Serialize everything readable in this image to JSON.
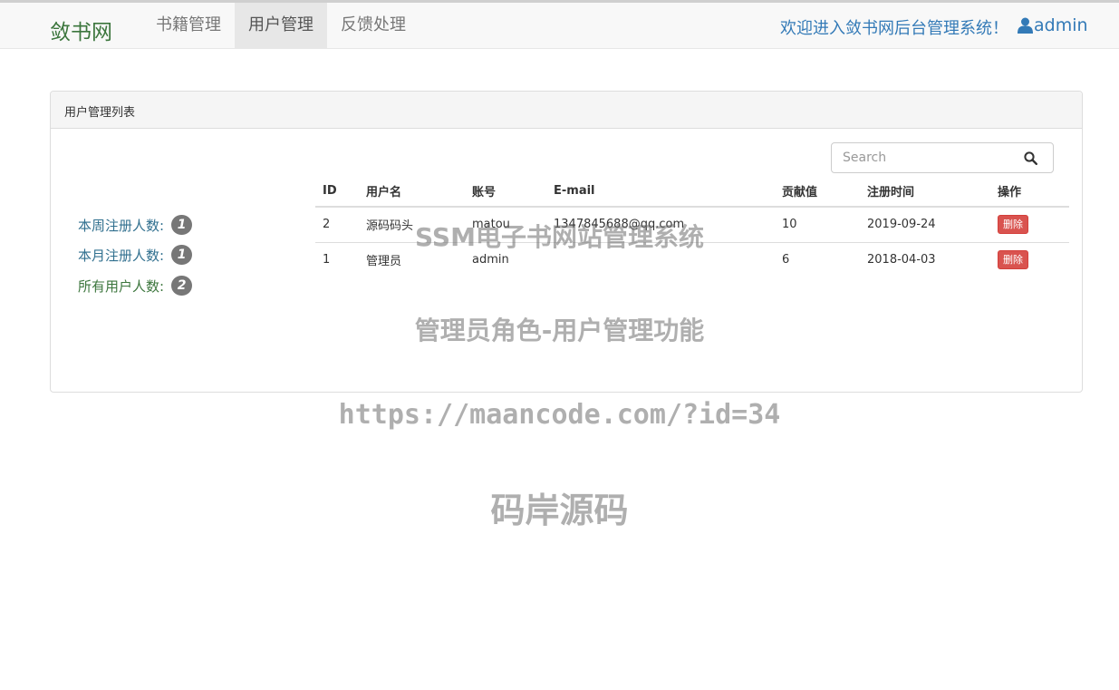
{
  "navbar": {
    "brand": "敛书网",
    "items": [
      {
        "label": "书籍管理"
      },
      {
        "label": "用户管理"
      },
      {
        "label": "反馈处理"
      }
    ],
    "welcome": "欢迎进入敛书网后台管理系统！",
    "user": "admin"
  },
  "panel": {
    "heading": "用户管理列表",
    "stats": [
      {
        "label": "本周注册人数:",
        "count": "1"
      },
      {
        "label": "本月注册人数:",
        "count": "1"
      },
      {
        "label": "所有用户人数:",
        "count": "2"
      }
    ],
    "search": {
      "placeholder": "Search"
    },
    "table": {
      "headers": [
        "ID",
        "用户名",
        "账号",
        "E-mail",
        "贡献值",
        "注册时间",
        "操作"
      ],
      "rows": [
        {
          "id": "2",
          "username": "源码码头",
          "account": "matou",
          "email": "1347845688@qq.com",
          "contribution": "10",
          "registered": "2019-09-24",
          "action": "删除"
        },
        {
          "id": "1",
          "username": "管理员",
          "account": "admin",
          "email": "",
          "contribution": "6",
          "registered": "2018-04-03",
          "action": "删除"
        }
      ]
    }
  },
  "watermark": {
    "line1": "SSM电子书网站管理系统",
    "line2": "管理员角色-用户管理功能",
    "line3": "https://maancode.com/?id=34",
    "line4": "码岸源码"
  },
  "colors": {
    "brand": "#3c763d",
    "link": "#337ab7",
    "danger": "#d9534f",
    "badge": "#777777"
  }
}
